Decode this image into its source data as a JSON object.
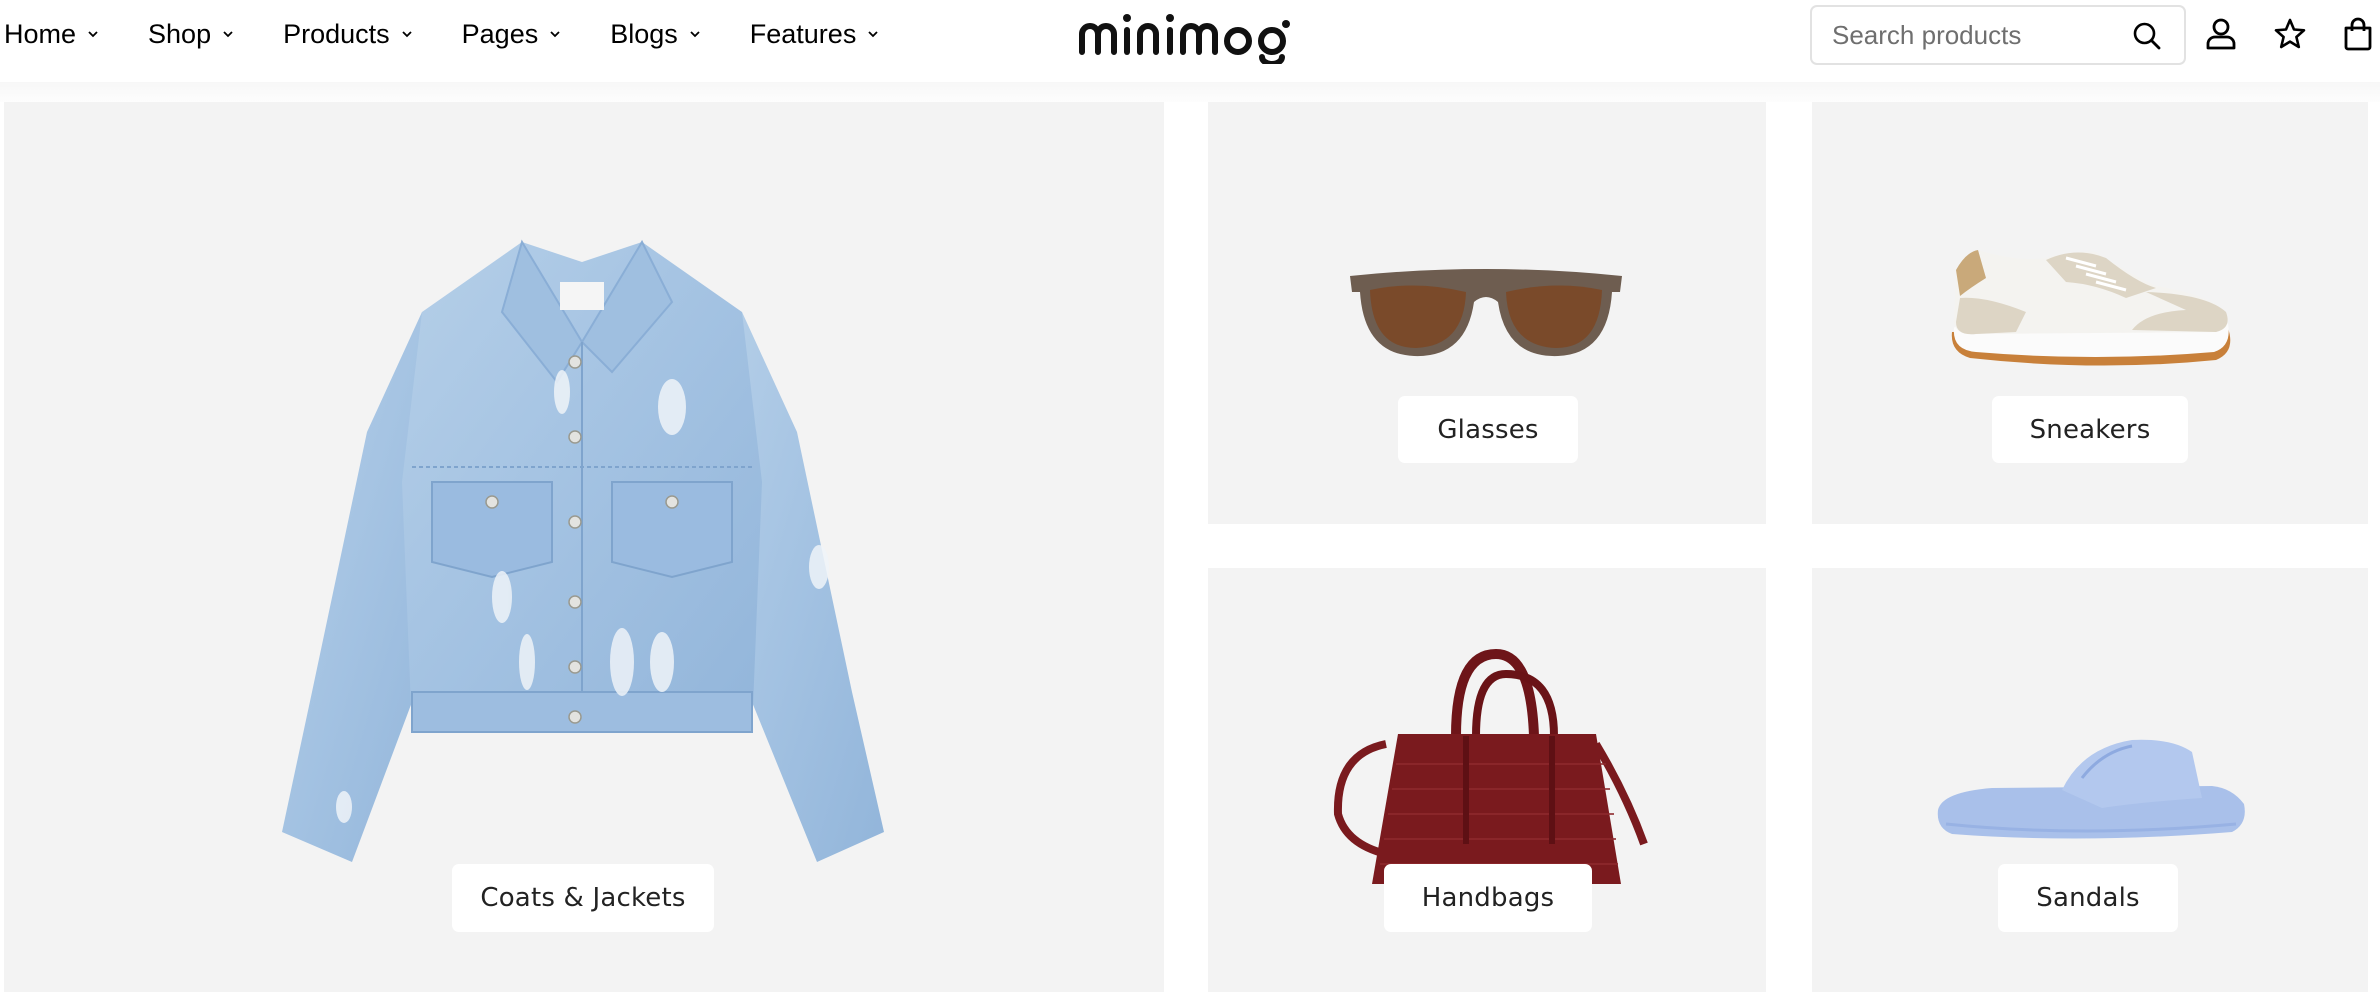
{
  "header": {
    "brand": "minimog",
    "nav": [
      {
        "label": "Home"
      },
      {
        "label": "Shop"
      },
      {
        "label": "Products"
      },
      {
        "label": "Pages"
      },
      {
        "label": "Blogs"
      },
      {
        "label": "Features"
      }
    ],
    "search": {
      "placeholder": "Search products",
      "value": ""
    },
    "icons": [
      "search-icon",
      "user-icon",
      "star-icon",
      "shopping-bag-icon"
    ]
  },
  "categories": [
    {
      "label": "Coats & Jackets",
      "image": "denim-jacket",
      "colors": {
        "main": "#a9c7e4",
        "dark": "#7ea7d1"
      }
    },
    {
      "label": "Glasses",
      "image": "brown-sunglasses",
      "colors": {
        "frame": "#6e5d50",
        "lens": "#7a4a2a"
      }
    },
    {
      "label": "Sneakers",
      "image": "white-beige-sneakers",
      "colors": {
        "upper": "#f6f6f4",
        "suede": "#ddd5c5",
        "sole": "#c8803a"
      }
    },
    {
      "label": "Handbags",
      "image": "red-croc-handbag",
      "colors": {
        "main": "#7a1a1e"
      }
    },
    {
      "label": "Sandals",
      "image": "blue-slide-sandals",
      "colors": {
        "main": "#a9c0ea"
      }
    }
  ],
  "colors": {
    "card_bg": "#f3f3f3",
    "text": "#111111"
  }
}
